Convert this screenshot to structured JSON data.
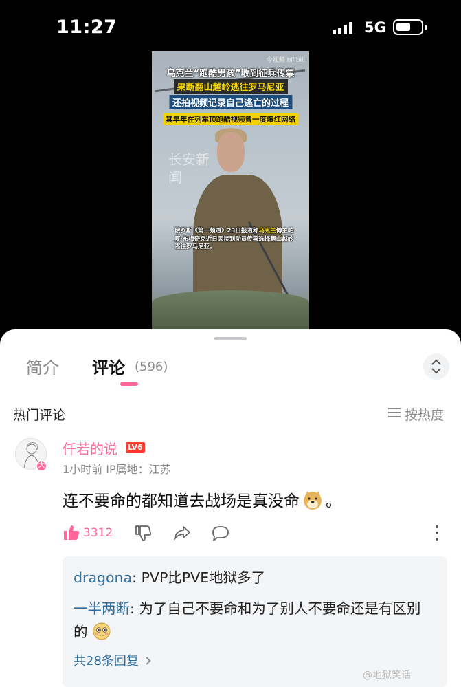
{
  "status_bar": {
    "time": "11:27",
    "network": "5G",
    "battery_level": 0.6
  },
  "video": {
    "watermark_top": "今视频 bilibili",
    "caption_1": "乌克兰“跑酷男孩”收到征兵传票",
    "caption_2": "果断翻山越岭逃往罗马尼亚",
    "caption_3": "还拍视频记录自己逃亡的过程",
    "caption_4": "其早年在列车顶跑酷视频曾一度爆红网络",
    "watermark_center": "长安新闻",
    "subtitle_prefix": "俄罗斯《第一频道》23日报道称",
    "subtitle_highlight": "乌克兰",
    "subtitle_rest": "博主帕夏·布梅奇克近日因接到动员传票选择翻山越岭逃往罗马尼亚。"
  },
  "tabs": {
    "intro": "简介",
    "comments": "评论",
    "comment_count": "(596)"
  },
  "comments_header": {
    "title": "热门评论",
    "sort_label": "按热度"
  },
  "comment": {
    "username": "仟若的说",
    "level": "LV6",
    "badge": "大",
    "meta": "1小时前  IP属地：江苏",
    "text": "连不要命的都知道去战场是真没命",
    "text_end": "。",
    "emoji": "doge-emoji",
    "like_count": "3312"
  },
  "replies": {
    "items": [
      {
        "name": "dragona",
        "sep": ": ",
        "text": "PVP比PVE地狱多了"
      },
      {
        "name": "一半两断",
        "sep": ": ",
        "text": "为了自己不要命和为了别人不要命还是有区别的"
      }
    ],
    "view_more": "共28条回复"
  },
  "corner_watermark": "@地狱笑话",
  "colors": {
    "accent": "#ff6699",
    "link": "#2e6f9e",
    "level": "#ff3b30"
  }
}
